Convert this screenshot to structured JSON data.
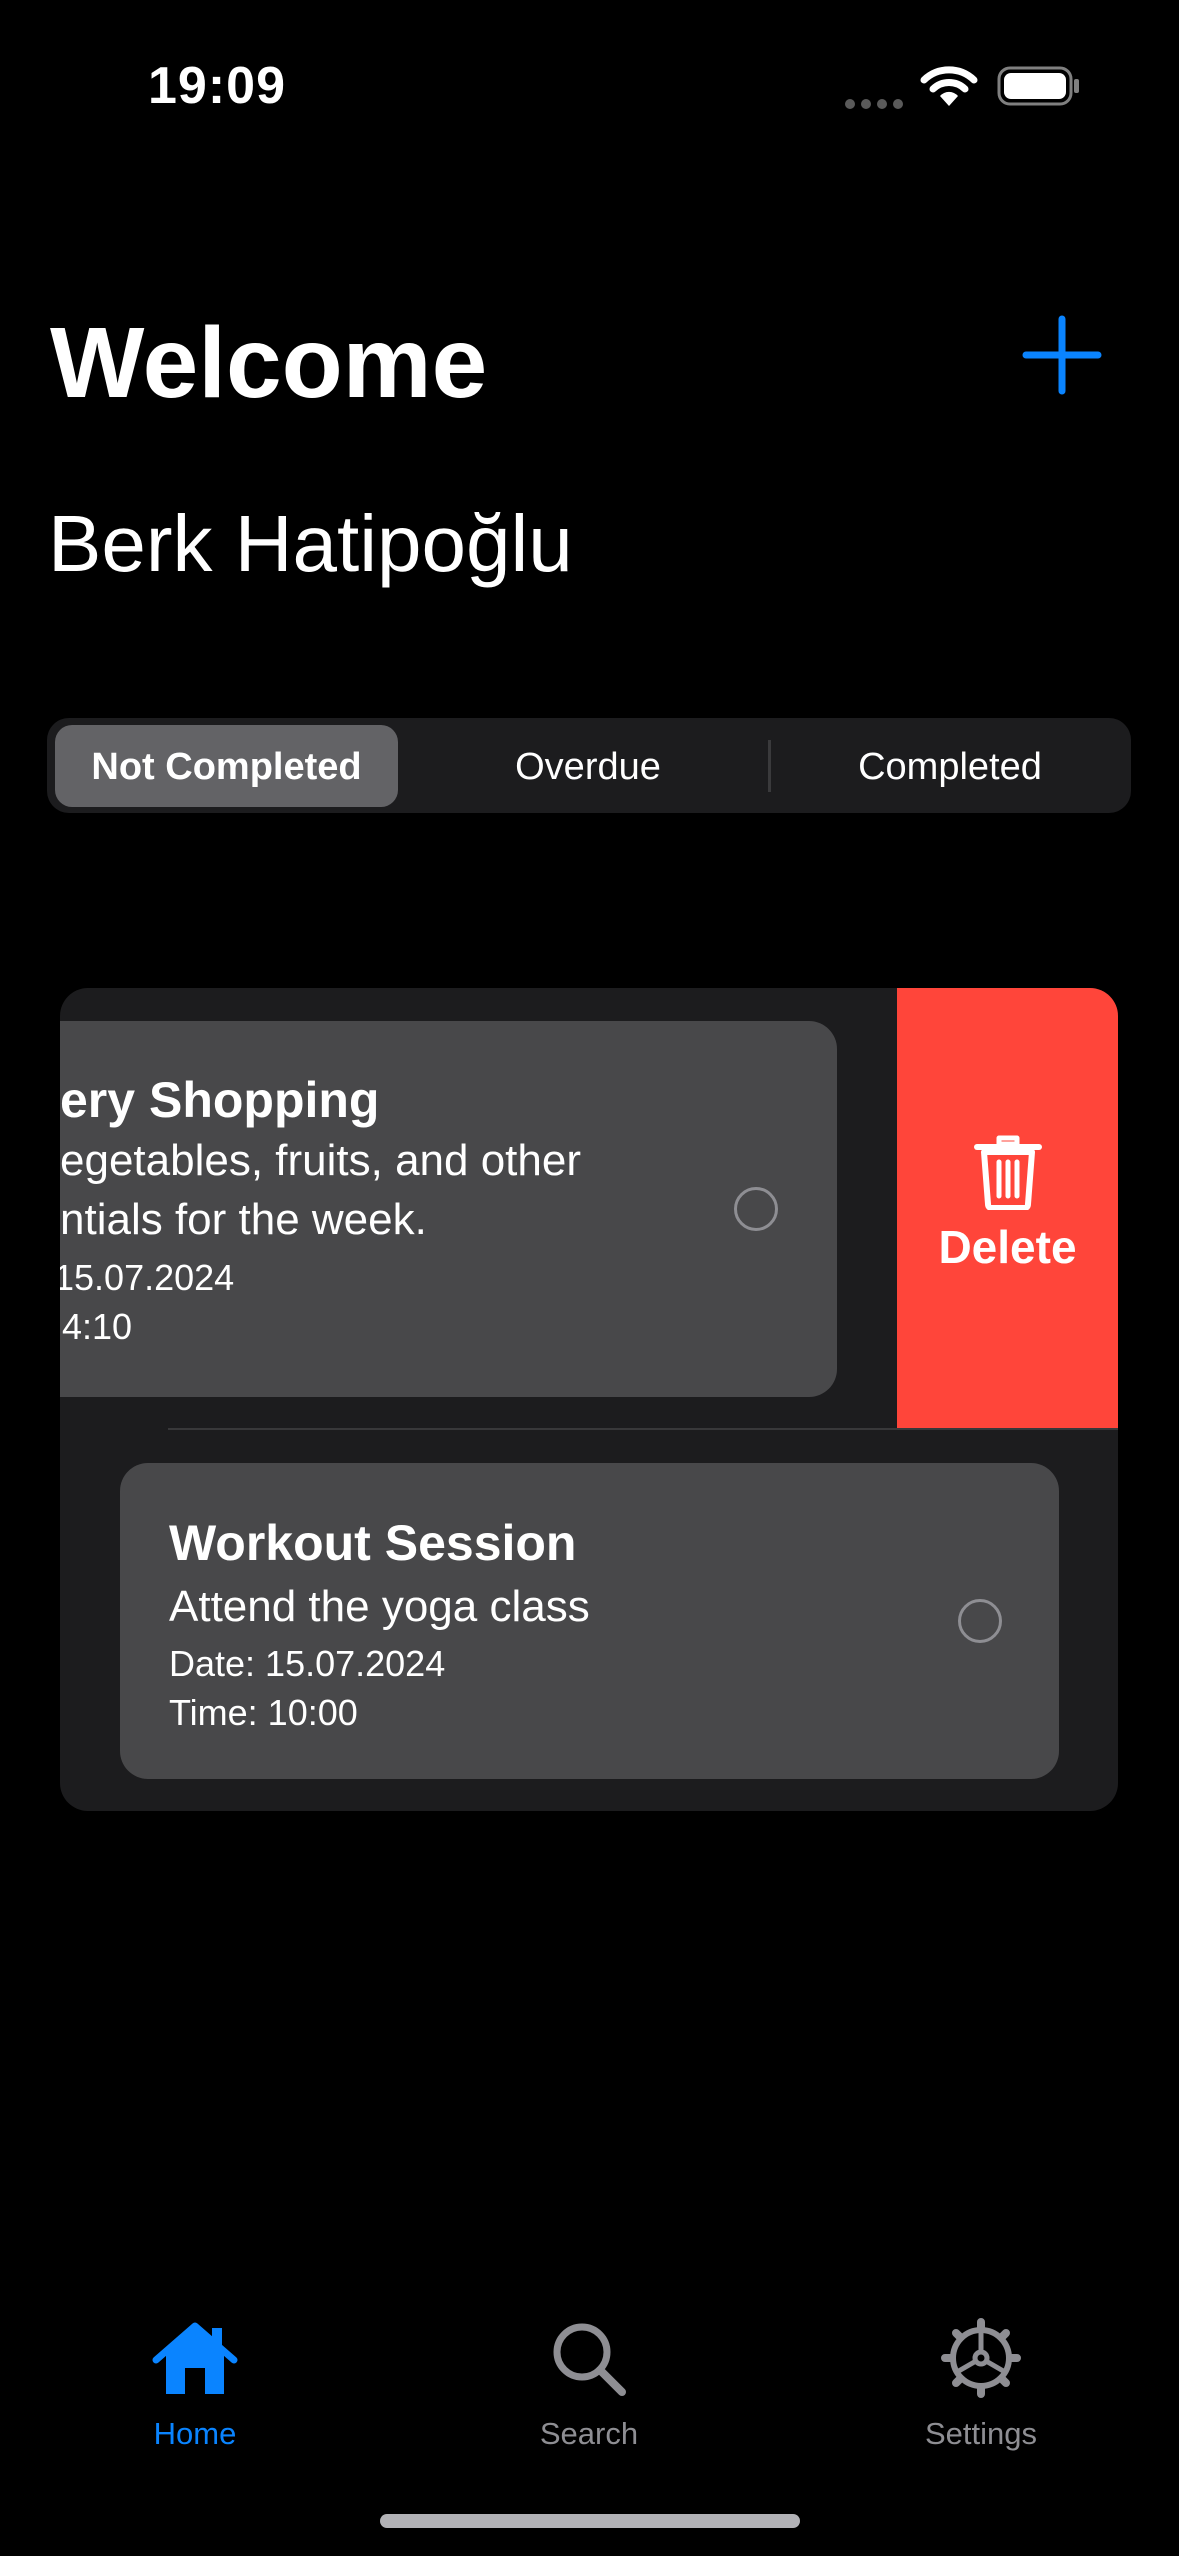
{
  "status_bar": {
    "time": "19:09",
    "wifi_icon": "wifi-icon",
    "battery_icon": "battery-icon"
  },
  "header": {
    "title": "Welcome",
    "user_name": "Berk Hatipoğlu",
    "add_icon": "plus-icon",
    "accent_color": "#0a84ff"
  },
  "segments": {
    "items": [
      {
        "label": "Not Completed",
        "selected": true
      },
      {
        "label": "Overdue",
        "selected": false
      },
      {
        "label": "Completed",
        "selected": false
      }
    ]
  },
  "tasks": [
    {
      "title": "ery Shopping",
      "description_line1": "egetables, fruits, and other",
      "description_line2": "ntials for the week.",
      "date": "15.07.2024",
      "time": "l4:10",
      "completed": false
    },
    {
      "title": "Workout Session",
      "description": "Attend the yoga class",
      "date": "Date: 15.07.2024",
      "time": "Time: 10:00",
      "completed": false
    }
  ],
  "swipe_action": {
    "label": "Delete",
    "icon": "trash-icon",
    "color": "#ff453a"
  },
  "tab_bar": {
    "items": [
      {
        "label": "Home",
        "icon": "house-icon",
        "active": true
      },
      {
        "label": "Search",
        "icon": "magnifying-glass-icon",
        "active": false
      },
      {
        "label": "Settings",
        "icon": "gear-icon",
        "active": false
      }
    ],
    "active_color": "#0a84ff",
    "inactive_color": "#8e8e93"
  }
}
